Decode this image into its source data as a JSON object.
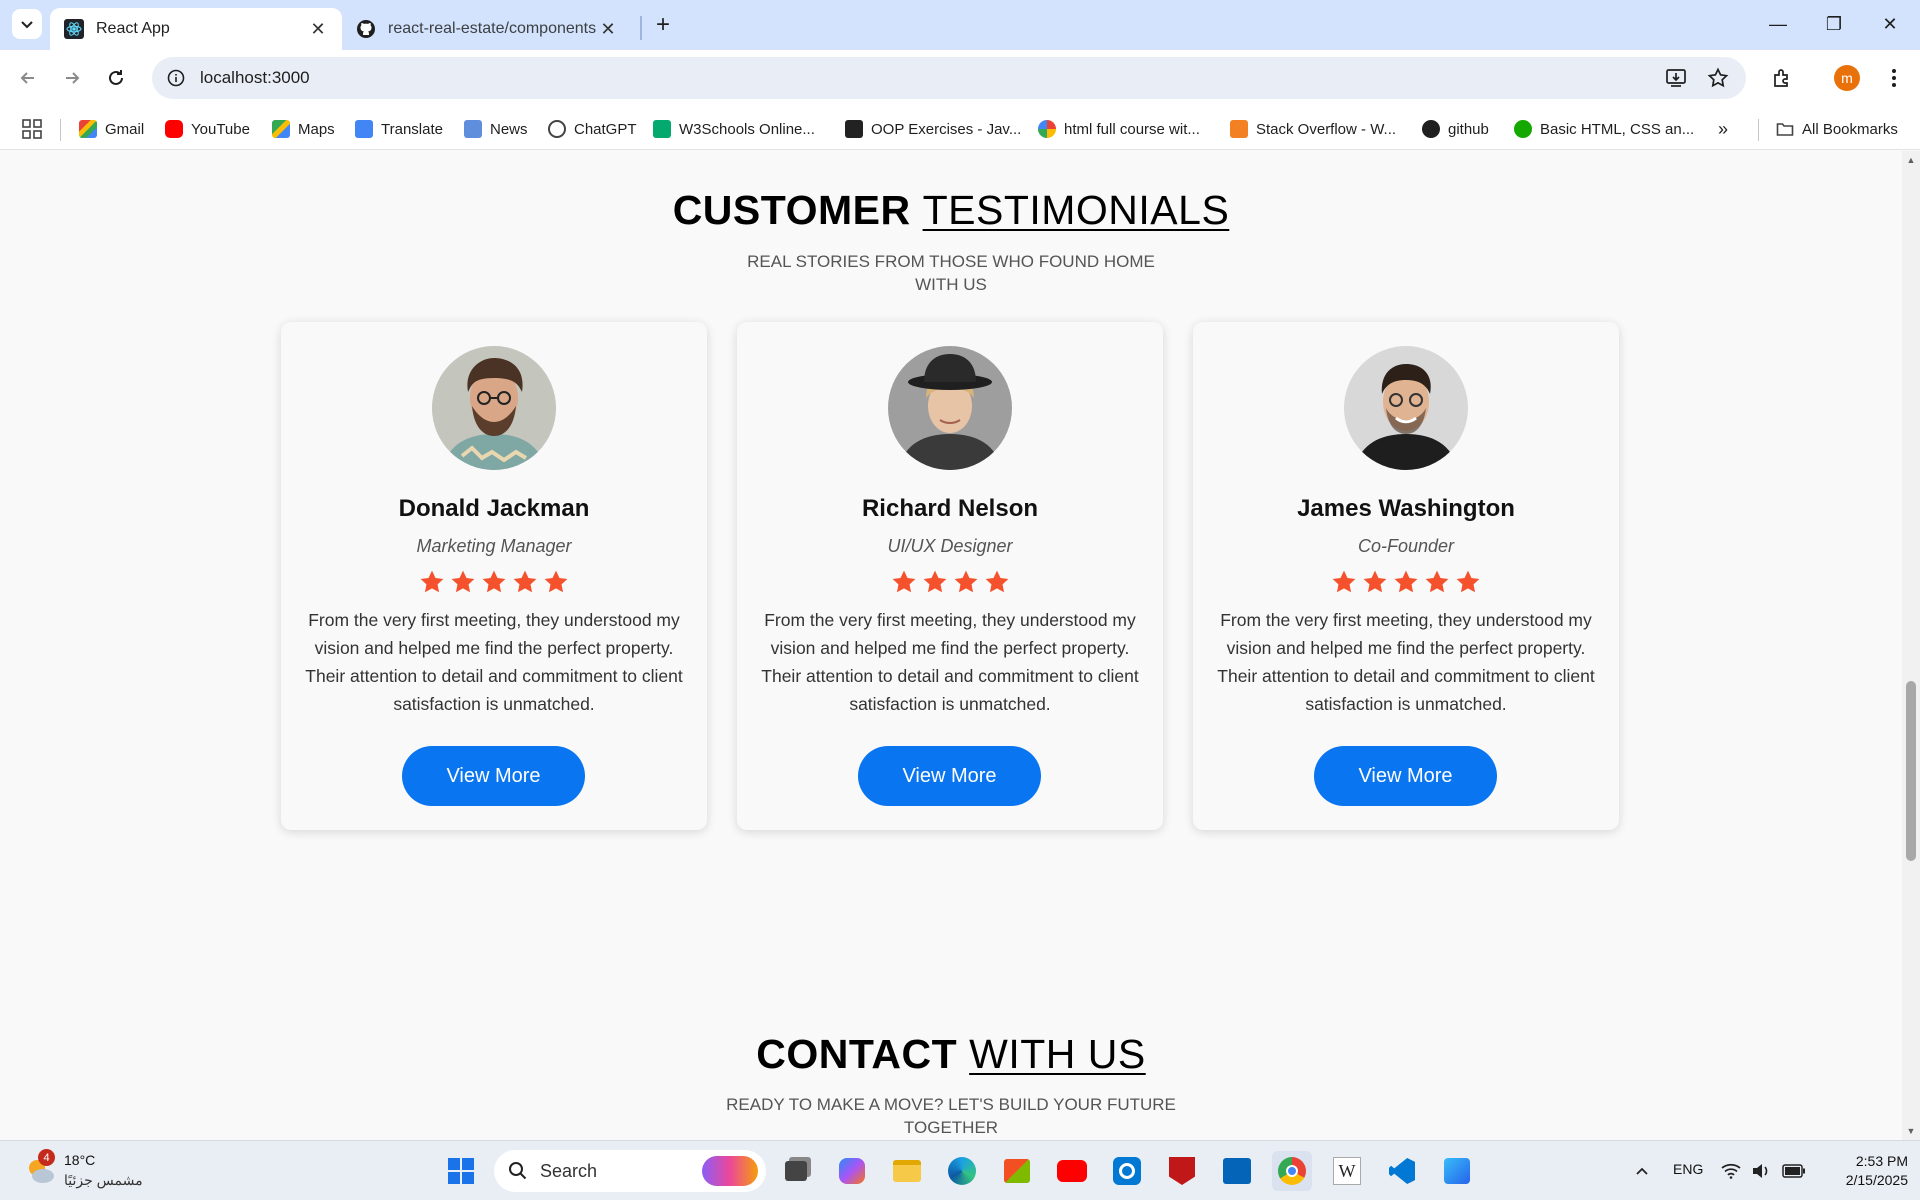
{
  "browser": {
    "tabs": [
      {
        "title": "React App",
        "active": true
      },
      {
        "title": "react-real-estate/components a",
        "active": false
      }
    ],
    "url": "localhost:3000",
    "profile_initial": "m",
    "bookmarks": [
      "Gmail",
      "YouTube",
      "Maps",
      "Translate",
      "News",
      "ChatGPT",
      "W3Schools Online...",
      "OOP Exercises - Jav...",
      "html full course wit...",
      "Stack Overflow - W...",
      "github",
      "Basic HTML, CSS an..."
    ],
    "all_bookmarks_label": "All Bookmarks"
  },
  "testimonials": {
    "title_bold": "CUSTOMER",
    "title_thin": "TESTIMONIALS",
    "subtitle_line1": "REAL STORIES FROM THOSE WHO FOUND HOME",
    "subtitle_line2": "WITH US",
    "cards": [
      {
        "name": "Donald Jackman",
        "role": "Marketing Manager",
        "rating": 5,
        "text": "From the very first meeting, they understood my vision and helped me find the perfect property. Their attention to detail and commitment to client satisfaction is unmatched.",
        "button": "View More"
      },
      {
        "name": "Richard Nelson",
        "role": "UI/UX Designer",
        "rating": 4,
        "text": "From the very first meeting, they understood my vision and helped me find the perfect property. Their attention to detail and commitment to client satisfaction is unmatched.",
        "button": "View More"
      },
      {
        "name": "James Washington",
        "role": "Co-Founder",
        "rating": 5,
        "text": "From the very first meeting, they understood my vision and helped me find the perfect property. Their attention to detail and commitment to client satisfaction is unmatched.",
        "button": "View More"
      }
    ]
  },
  "contact": {
    "title_bold": "CONTACT",
    "title_thin": "WITH US",
    "subtitle_line1": "READY TO MAKE A MOVE? LET'S BUILD YOUR FUTURE",
    "subtitle_line2": "TOGETHER"
  },
  "taskbar": {
    "weather_temp": "18°C",
    "weather_desc": "مشمس جزئيًا",
    "weather_badge": "4",
    "search_placeholder": "Search",
    "language": "ENG",
    "time": "2:53 PM",
    "date": "2/15/2025"
  },
  "colors": {
    "accent_button": "#0a75f0",
    "star": "#f4512c",
    "tab_bar": "#d3e3fd"
  }
}
